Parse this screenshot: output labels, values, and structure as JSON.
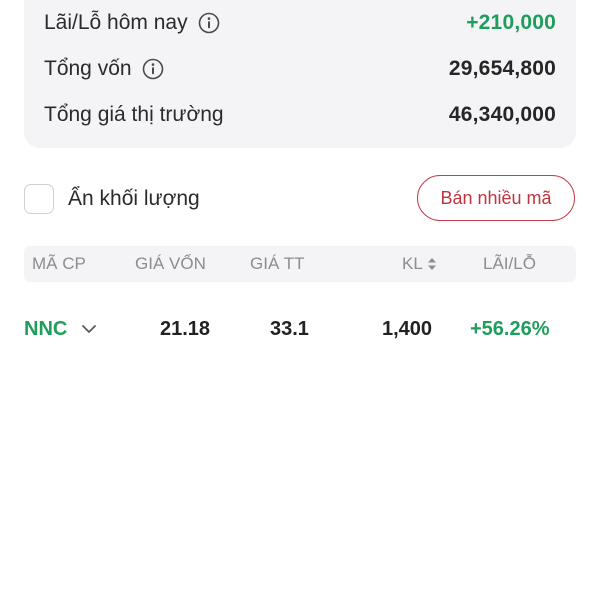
{
  "summary": {
    "pnl_today_label": "Lãi/Lỗ hôm nay",
    "pnl_today_value": "+210,000",
    "total_capital_label": "Tổng vốn",
    "total_capital_value": "29,654,800",
    "market_value_label": "Tổng giá thị trường",
    "market_value_value": "46,340,000"
  },
  "controls": {
    "hide_volume_label": "Ẩn khối lượng",
    "hide_volume_checked": false,
    "sell_many_label": "Bán nhiều mã"
  },
  "table": {
    "headers": {
      "ticker": "MÃ CP",
      "cost_price": "GIÁ VỐN",
      "market_price": "GIÁ TT",
      "volume": "KL",
      "pnl": "LÃI/LỖ"
    },
    "rows": [
      {
        "ticker": "NNC",
        "cost_price": "21.18",
        "market_price": "33.1",
        "volume": "1,400",
        "pnl": "+56.26%"
      }
    ]
  },
  "colors": {
    "positive": "#1f9d5c",
    "sell_button": "#c0333f",
    "card_background": "#f4f4f6"
  },
  "icons": {
    "info": "info-circle-icon",
    "sort": "sort-updown-icon",
    "expand": "chevron-down-icon"
  }
}
